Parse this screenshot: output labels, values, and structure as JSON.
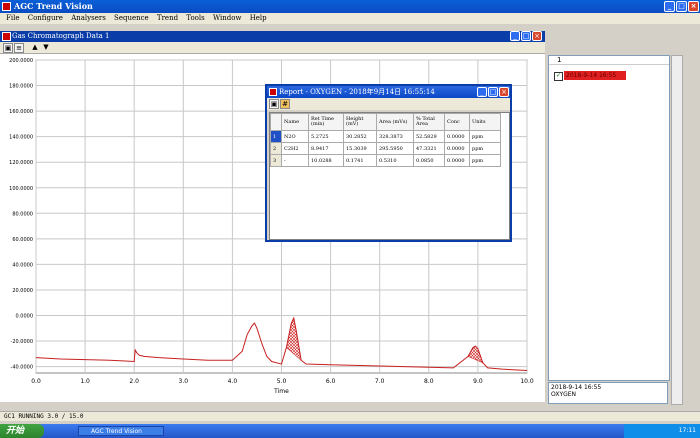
{
  "app": {
    "title": "AGC Trend Vision",
    "menu": [
      "File",
      "Configure",
      "Analysers",
      "Sequence",
      "Trend",
      "Tools",
      "Window",
      "Help"
    ]
  },
  "child_window": {
    "title": "Gas Chromatograph Data 1"
  },
  "report": {
    "title": "Report - OXYGEN - 2018年9月14日 16:55:14",
    "columns": [
      "Name",
      "Ret Time (min)",
      "Height (mV)",
      "Area (mVs)",
      "% Total Area",
      "Conc",
      "Units"
    ],
    "rows": [
      {
        "idx": "1",
        "name": "N2O",
        "ret": "5.2725",
        "height": "30.2852",
        "area": "328.3873",
        "pct": "52.5829",
        "conc": "0.0000",
        "units": "ppm"
      },
      {
        "idx": "2",
        "name": "C2H2",
        "ret": "8.9417",
        "height": "15.3039",
        "area": "295.5950",
        "pct": "47.3321",
        "conc": "0.0000",
        "units": "ppm"
      },
      {
        "idx": "3",
        "name": "-",
        "ret": "10.0288",
        "height": "0.1741",
        "area": "0.5310",
        "pct": "0.0850",
        "conc": "0.0000",
        "units": "ppm"
      }
    ]
  },
  "right_panel": {
    "header": "1",
    "legend_label": "2018-9-14 16:55",
    "info_line1": "2018-9-14 16:55",
    "info_line2": "OXYGEN"
  },
  "status": {
    "text": "GC1 RUNNING 3.0 / 15.0"
  },
  "taskbar": {
    "start": "开始",
    "task": "AGC Trend Vision",
    "clock": "17:11"
  },
  "colors": {
    "trace": "#c82020",
    "grid": "#c8c8c8",
    "fill": "#d02020"
  },
  "chart_data": {
    "type": "line",
    "xlabel": "Time",
    "ylabel": "",
    "xlim": [
      0,
      10
    ],
    "ylim": [
      -45,
      200
    ],
    "x_ticks": [
      "0.0",
      "1.0",
      "2.0",
      "3.0",
      "4.0",
      "5.0",
      "6.0",
      "7.0",
      "8.0",
      "9.0",
      "10.0"
    ],
    "y_ticks": [
      "200.0000",
      "180.0000",
      "160.0000",
      "140.0000",
      "120.0000",
      "100.0000",
      "80.0000",
      "60.0000",
      "40.0000",
      "20.0000",
      "0.0000",
      "-20.0000",
      "-40.0000"
    ],
    "y_tick_values": [
      200,
      180,
      160,
      140,
      120,
      100,
      80,
      60,
      40,
      20,
      0,
      -20,
      -40
    ],
    "series": [
      {
        "x": [
          0,
          0.5,
          1.0,
          1.5,
          2.0,
          2.02,
          2.05,
          2.1,
          2.2,
          2.5,
          3.0,
          3.5,
          4.0,
          4.2,
          4.3,
          4.4,
          4.45,
          4.5,
          4.6,
          4.7,
          4.8,
          5.0,
          5.1,
          5.2,
          5.25,
          5.3,
          5.4,
          5.5,
          6.0,
          6.5,
          7.0,
          7.5,
          8.0,
          8.5,
          8.8,
          8.9,
          8.95,
          9.0,
          9.1,
          9.2,
          9.5,
          10.0
        ],
        "y": [
          -33,
          -34,
          -34.5,
          -35,
          -36,
          -27,
          -29,
          -31,
          -32,
          -33,
          -34,
          -35,
          -35,
          -28,
          -15,
          -8,
          -6,
          -10,
          -22,
          -32,
          -36,
          -38,
          -25,
          -6,
          -2,
          -12,
          -35,
          -38,
          -38.5,
          -39,
          -39.5,
          -40,
          -40.5,
          -41,
          -32,
          -25,
          -24,
          -26,
          -37,
          -41,
          -42,
          -43
        ]
      }
    ]
  }
}
